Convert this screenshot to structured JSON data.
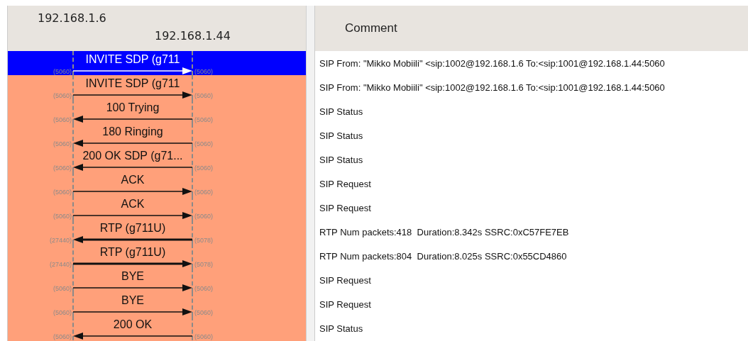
{
  "flow": {
    "hosts": [
      {
        "address": "192.168.1.6"
      },
      {
        "address": "192.168.1.44"
      }
    ],
    "rows": [
      {
        "label": "INVITE SDP (g711",
        "to_right": true,
        "kind": "sip",
        "left_port": "(5060)",
        "right_port": "(5060)",
        "selected": true
      },
      {
        "label": "INVITE SDP (g711",
        "to_right": true,
        "kind": "sip",
        "left_port": "(5060)",
        "right_port": "(5060)",
        "selected": false
      },
      {
        "label": "100 Trying",
        "to_right": false,
        "kind": "sip",
        "left_port": "(5060)",
        "right_port": "(5060)",
        "selected": false
      },
      {
        "label": "180 Ringing",
        "to_right": false,
        "kind": "sip",
        "left_port": "(5060)",
        "right_port": "(5060)",
        "selected": false
      },
      {
        "label": "200 OK SDP (g71...",
        "to_right": false,
        "kind": "sip",
        "left_port": "(5060)",
        "right_port": "(5060)",
        "selected": false
      },
      {
        "label": "ACK",
        "to_right": true,
        "kind": "sip",
        "left_port": "(5060)",
        "right_port": "(5060)",
        "selected": false
      },
      {
        "label": "ACK",
        "to_right": true,
        "kind": "sip",
        "left_port": "(5060)",
        "right_port": "(5060)",
        "selected": false
      },
      {
        "label": "RTP (g711U)",
        "to_right": false,
        "kind": "rtp",
        "left_port": "(27440)",
        "right_port": "(5078)",
        "selected": false
      },
      {
        "label": "RTP (g711U)",
        "to_right": true,
        "kind": "rtp",
        "left_port": "(27440)",
        "right_port": "(5078)",
        "selected": false
      },
      {
        "label": "BYE",
        "to_right": true,
        "kind": "sip",
        "left_port": "(5060)",
        "right_port": "(5060)",
        "selected": false
      },
      {
        "label": "BYE",
        "to_right": true,
        "kind": "sip",
        "left_port": "(5060)",
        "right_port": "(5060)",
        "selected": false
      },
      {
        "label": "200 OK",
        "to_right": false,
        "kind": "sip",
        "left_port": "(5060)",
        "right_port": "(5060)",
        "selected": false
      }
    ]
  },
  "comments": {
    "heading": "Comment",
    "rows": [
      "SIP From: \"Mikko Mobiili\" <sip:1002@192.168.1.6 To:<sip:1001@192.168.1.44:5060",
      "SIP From: \"Mikko Mobiili\" <sip:1002@192.168.1.6 To:<sip:1001@192.168.1.44:5060",
      "SIP Status",
      "SIP Status",
      "SIP Status",
      "SIP Request",
      "SIP Request",
      "RTP Num packets:418  Duration:8.342s SSRC:0xC57FE7EB",
      "RTP Num packets:804  Duration:8.025s SSRC:0x55CD4860",
      "SIP Request",
      "SIP Request",
      "SIP Status"
    ]
  }
}
